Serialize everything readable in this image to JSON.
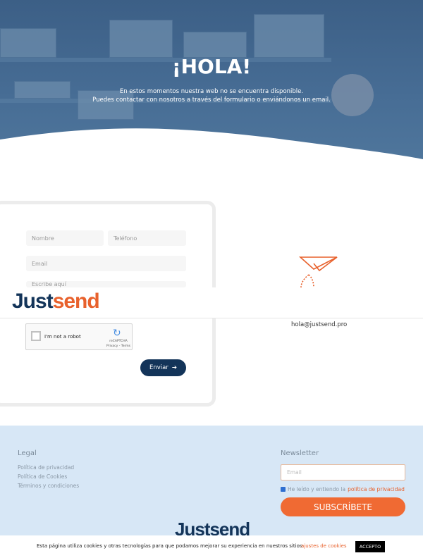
{
  "hero": {
    "title": "¡HOLA!",
    "line1": "En estos momentos nuestra web no se encuentra disponible.",
    "line2": "Puedes contactar con nosotros a través del formulario o enviándonos un email."
  },
  "form": {
    "name_placeholder": "Nombre",
    "phone_placeholder": "Teléfono",
    "email_placeholder": "Email",
    "message_placeholder": "Escribe aquí",
    "recaptcha_label": "I'm not a robot",
    "recaptcha_brand": "reCAPTCHA",
    "recaptcha_links": "Privacy - Terms",
    "send_label": "Enviar"
  },
  "header": {
    "logo_part1": "Just",
    "logo_part2": "send"
  },
  "contact": {
    "email": "hola@justsend.pro"
  },
  "footer": {
    "legal_title": "Legal",
    "legal_links": [
      "Política de privacidad",
      "Política de Cookies",
      "Términos y condiciones"
    ],
    "newsletter_title": "Newsletter",
    "newsletter_placeholder": "Email",
    "consent_text": "He leído y entiendo la",
    "consent_link": "política de privacidad",
    "subscribe_label": "SUBSCRÍBETE",
    "logo": "Justsend"
  },
  "cookie": {
    "text": "Esta página utiliza cookies y otras tecnologías para que podamos mejorar su experiencia en nuestros sitios:",
    "settings": "ajustes de cookies",
    "accept": "ACCEPTO"
  }
}
